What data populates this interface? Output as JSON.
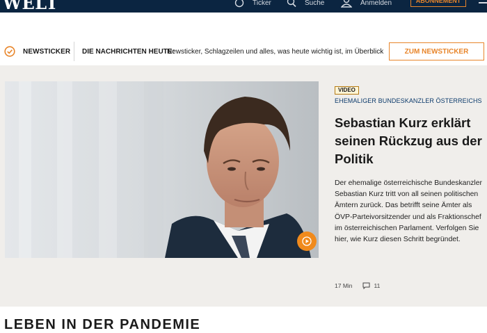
{
  "header": {
    "logo": "WELT",
    "nav": {
      "ticker": "Ticker",
      "suche": "Suche",
      "anmelden": "Anmelden"
    },
    "abo_button": "ABONNEMENT"
  },
  "newsticker": {
    "label": "NEWSTICKER",
    "headline": "DIE NACHRICHTEN HEUTE:",
    "text": "Newsticker, Schlagzeilen und alles, was heute wichtig ist, im Überblick",
    "button": "ZUM NEWSTICKER"
  },
  "feature": {
    "badge": "VIDEO",
    "kicker": "EHEMALIGER BUNDESKANZLER ÖSTERREICHS",
    "headline": "Sebastian Kurz erklärt seinen Rückzug aus der Politik",
    "teaser": "Der ehemalige österreichische Bundeskanzler Sebastian Kurz tritt von all seinen politischen Ämtern zurück. Das betrifft seine Ämter als ÖVP-Parteivorsitzender und als Fraktionschef im österreichischen Parlament. Verfolgen Sie hier, wie Kurz diesen Schritt begründet.",
    "duration": "17 Min",
    "comments": "11"
  },
  "next_section": {
    "heading": "LEBEN IN DER PANDEMIE"
  },
  "colors": {
    "header_bg": "#0b2541",
    "accent": "#e8852a",
    "panel_bg": "#f0eeeb",
    "kicker": "#0b3a6b"
  }
}
